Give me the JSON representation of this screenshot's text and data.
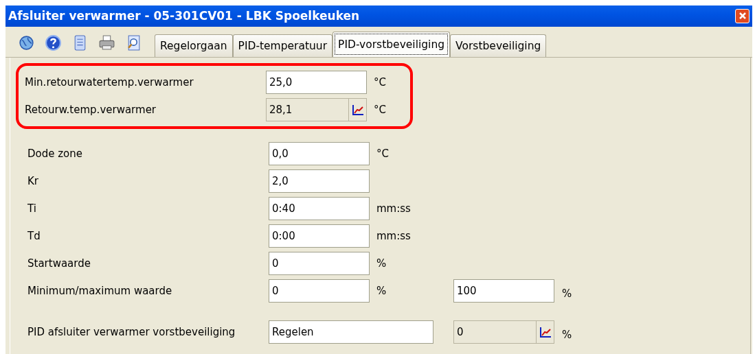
{
  "window": {
    "title": "Afsluiter verwarmer - 05-301CV01 - LBK Spoelkeuken"
  },
  "toolbar": [
    {
      "kind": "globe"
    },
    {
      "kind": "help"
    },
    {
      "kind": "document"
    },
    {
      "kind": "print"
    },
    {
      "kind": "preview"
    }
  ],
  "tabs": [
    {
      "label": "Regelorgaan",
      "selected": false
    },
    {
      "label": "PID-temperatuur",
      "selected": false
    },
    {
      "label": "PID-vorstbeveiliging",
      "selected": true
    },
    {
      "label": "Vorstbeveiliging",
      "selected": false
    }
  ],
  "groups": [
    {
      "highlighted": true,
      "rows": [
        {
          "label": "Min.retourwatertemp.verwarmer",
          "field": {
            "kind": "number",
            "value": "25,0"
          },
          "unit": "°C"
        },
        {
          "label": "Retourw.temp.verwarmer",
          "field": {
            "kind": "readonly",
            "value": "28,1"
          },
          "unit": "°C"
        }
      ]
    },
    {
      "highlighted": false,
      "rows": [
        {
          "label": "Dode zone",
          "field": {
            "kind": "number",
            "value": "0,0"
          },
          "unit": "°C"
        },
        {
          "label": "Kr",
          "field": {
            "kind": "number",
            "value": "2,0"
          }
        },
        {
          "label": "Ti",
          "field": {
            "kind": "number",
            "value": "0:40"
          },
          "unit": "mm:ss"
        },
        {
          "label": "Td",
          "field": {
            "kind": "number",
            "value": "0:00"
          },
          "unit": "mm:ss"
        },
        {
          "label": "Startwaarde",
          "field": {
            "kind": "number",
            "value": "0"
          },
          "unit": "%"
        },
        {
          "label": "Minimum/maximum waarde",
          "field": {
            "kind": "number",
            "value": "0"
          },
          "unit": "%",
          "field2": {
            "kind": "number",
            "value": "100"
          },
          "unit2": "%"
        }
      ]
    },
    {
      "highlighted": false,
      "rows": [
        {
          "label": "PID afsluiter verwarmer vorstbeveiliging",
          "field": {
            "kind": "text",
            "value": "Regelen"
          },
          "field2": {
            "kind": "readonly",
            "value": "0"
          },
          "unit2": "%"
        }
      ]
    }
  ]
}
